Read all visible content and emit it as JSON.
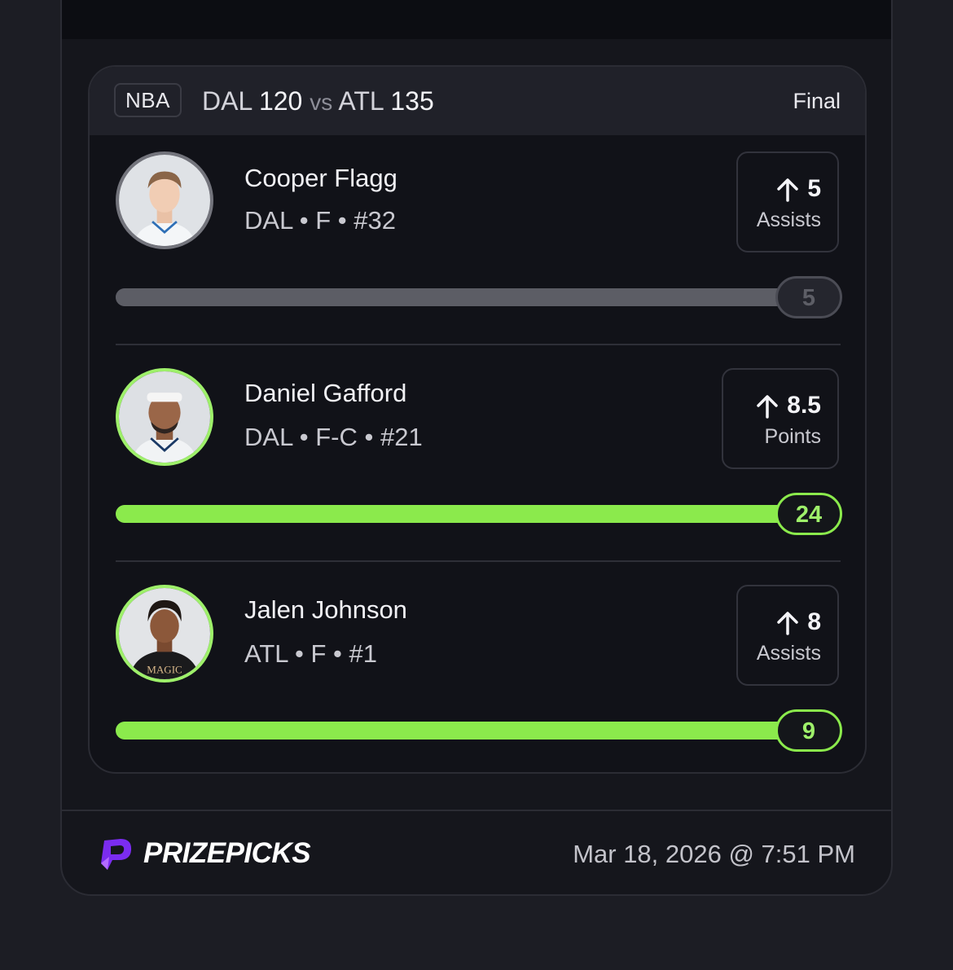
{
  "game": {
    "league": "NBA",
    "away_team": "DAL",
    "away_score": "120",
    "vs": "vs",
    "home_team": "ATL",
    "home_score": "135",
    "status": "Final"
  },
  "players": [
    {
      "name": "Cooper Flagg",
      "meta": "DAL • F • #32",
      "line": "5",
      "stat": "Assists",
      "result": "5",
      "result_progress": 1.0,
      "state": "push"
    },
    {
      "name": "Daniel Gafford",
      "meta": "DAL • F-C • #21",
      "line": "8.5",
      "stat": "Points",
      "result": "24",
      "result_progress": 1.0,
      "state": "hit"
    },
    {
      "name": "Jalen Johnson",
      "meta": "ATL • F • #1",
      "line": "8",
      "stat": "Assists",
      "result": "9",
      "result_progress": 1.0,
      "state": "hit"
    }
  ],
  "footer": {
    "brand": "PRIZEPICKS",
    "timestamp": "Mar 18, 2026 @ 7:51 PM"
  },
  "colors": {
    "hit": "#8bea4c",
    "push": "#5c5d65",
    "brand_purple": "#7b2cf0"
  }
}
